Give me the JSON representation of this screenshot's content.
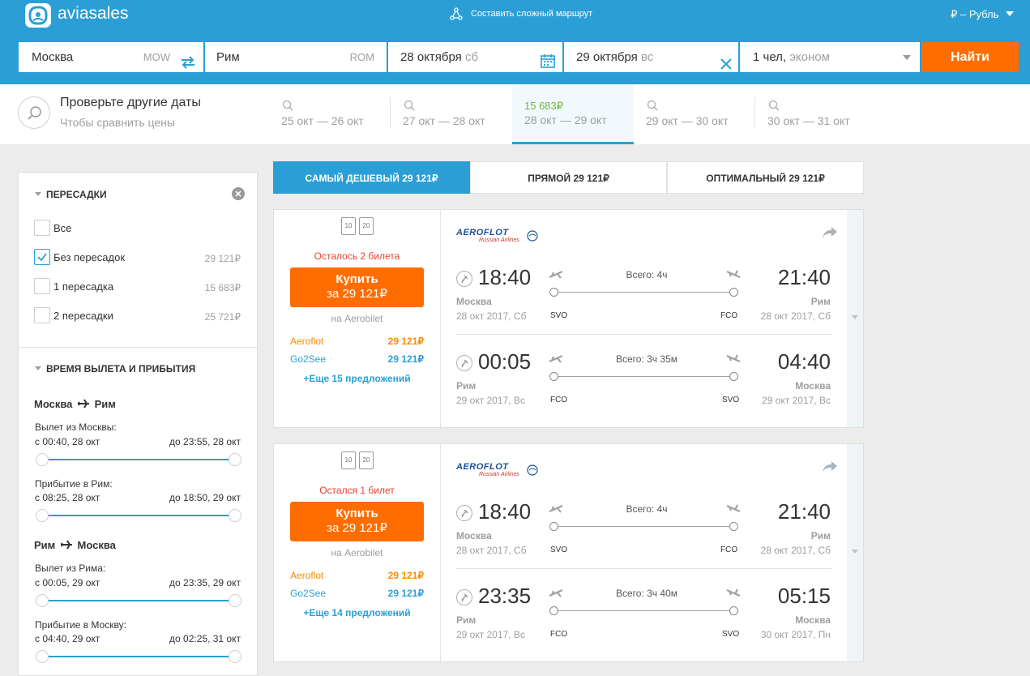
{
  "header": {
    "logo_text": "aviasales",
    "route_label": "Составить сложный маршрут",
    "currency": "₽ – Рубль"
  },
  "search": {
    "origin": {
      "city": "Москва",
      "code": "MOW"
    },
    "destination": {
      "city": "Рим",
      "code": "ROM"
    },
    "depart": {
      "date": "28 октября",
      "day": "сб"
    },
    "return": {
      "date": "29 октября",
      "day": "вс"
    },
    "passengers": {
      "count": "1 чел,",
      "class": "эконом"
    },
    "button": "Найти"
  },
  "dates": {
    "title": "Проверьте другие даты",
    "subtitle": "Чтобы сравнить цены",
    "items": [
      {
        "label": "25 окт — 26 окт",
        "price": ""
      },
      {
        "label": "27 окт — 28 окт",
        "price": ""
      },
      {
        "label": "28 окт — 29 окт",
        "price": "15 683₽",
        "active": true
      },
      {
        "label": "29 окт — 30 окт",
        "price": ""
      },
      {
        "label": "30 окт — 31 окт",
        "price": ""
      }
    ]
  },
  "filters": {
    "stops_title": "Пересадки",
    "stops": [
      {
        "label": "Все",
        "price": "",
        "checked": false
      },
      {
        "label": "Без пересадок",
        "price": "29 121₽",
        "checked": true
      },
      {
        "label": "1 пересадка",
        "price": "15 683₽",
        "checked": false
      },
      {
        "label": "2 пересадки",
        "price": "25 721₽",
        "checked": false
      }
    ],
    "time_title": "Время вылета и прибытия",
    "legs": [
      {
        "from": "Москва",
        "to": "Рим",
        "sliders": [
          {
            "label": "Вылет из Москвы:",
            "from": "с 00:40, 28 окт",
            "to": "до 23:55, 28 окт"
          },
          {
            "label": "Прибытие в Рим:",
            "from": "с 08:25, 28 окт",
            "to": "до 18:50, 29 окт"
          }
        ]
      },
      {
        "from": "Рим",
        "to": "Москва",
        "sliders": [
          {
            "label": "Вылет из Рима:",
            "from": "с 00:05, 29 окт",
            "to": "до 23:35, 29 окт"
          },
          {
            "label": "Прибытие в Москву:",
            "from": "с 04:40, 29 окт",
            "to": "до 02:25, 31 окт"
          }
        ]
      }
    ]
  },
  "tabs": [
    {
      "label": "Самый дешевый",
      "price": "29 121₽",
      "active": true
    },
    {
      "label": "Прямой",
      "price": "29 121₽",
      "active": false
    },
    {
      "label": "Оптимальный",
      "price": "29 121₽",
      "active": false
    }
  ],
  "tickets": [
    {
      "baggage": [
        "10",
        "20"
      ],
      "remaining": "Осталось 2 билета",
      "buy_label": "Купить",
      "buy_price": "за 29 121₽",
      "agency": "на Aerobilet",
      "offers": [
        {
          "name": "Aeroflot",
          "price": "29 121₽",
          "color": "#ff8a00"
        },
        {
          "name": "Go2See",
          "price": "29 121₽",
          "color": "#2b9fd5"
        }
      ],
      "more": "+Еще 15 предложений",
      "airline": {
        "name": "AEROFLOT",
        "sub": "Russian Airlines"
      },
      "segments": [
        {
          "dep_time": "18:40",
          "dep_city": "Москва",
          "dep_date": "28 окт 2017, Сб",
          "arr_time": "21:40",
          "arr_city": "Рим",
          "arr_date": "28 окт 2017, Сб",
          "duration": "Всего: 4ч",
          "from_code": "SVO",
          "to_code": "FCO"
        },
        {
          "dep_time": "00:05",
          "dep_city": "Рим",
          "dep_date": "29 окт 2017, Вс",
          "arr_time": "04:40",
          "arr_city": "Москва",
          "arr_date": "29 окт 2017, Вс",
          "duration": "Всего: 3ч 35м",
          "from_code": "FCO",
          "to_code": "SVO"
        }
      ]
    },
    {
      "baggage": [
        "10",
        "20"
      ],
      "remaining": "Остался 1 билет",
      "buy_label": "Купить",
      "buy_price": "за 29 121₽",
      "agency": "на Aerobilet",
      "offers": [
        {
          "name": "Aeroflot",
          "price": "29 121₽",
          "color": "#ff8a00"
        },
        {
          "name": "Go2See",
          "price": "29 121₽",
          "color": "#2b9fd5"
        }
      ],
      "more": "+Еще 14 предложений",
      "airline": {
        "name": "AEROFLOT",
        "sub": "Russian Airlines"
      },
      "segments": [
        {
          "dep_time": "18:40",
          "dep_city": "Москва",
          "dep_date": "28 окт 2017, Сб",
          "arr_time": "21:40",
          "arr_city": "Рим",
          "arr_date": "28 окт 2017, Сб",
          "duration": "Всего: 4ч",
          "from_code": "SVO",
          "to_code": "FCO"
        },
        {
          "dep_time": "23:35",
          "dep_city": "Рим",
          "dep_date": "29 окт 2017, Вс",
          "arr_time": "05:15",
          "arr_city": "Москва",
          "arr_date": "30 окт 2017, Пн",
          "duration": "Всего: 3ч 40м",
          "from_code": "FCO",
          "to_code": "SVO"
        }
      ]
    }
  ],
  "colors": {
    "brand": "#2b9fd5",
    "cta": "#ff6d00",
    "price_green": "#6db33f",
    "alert_red": "#e8412c"
  }
}
